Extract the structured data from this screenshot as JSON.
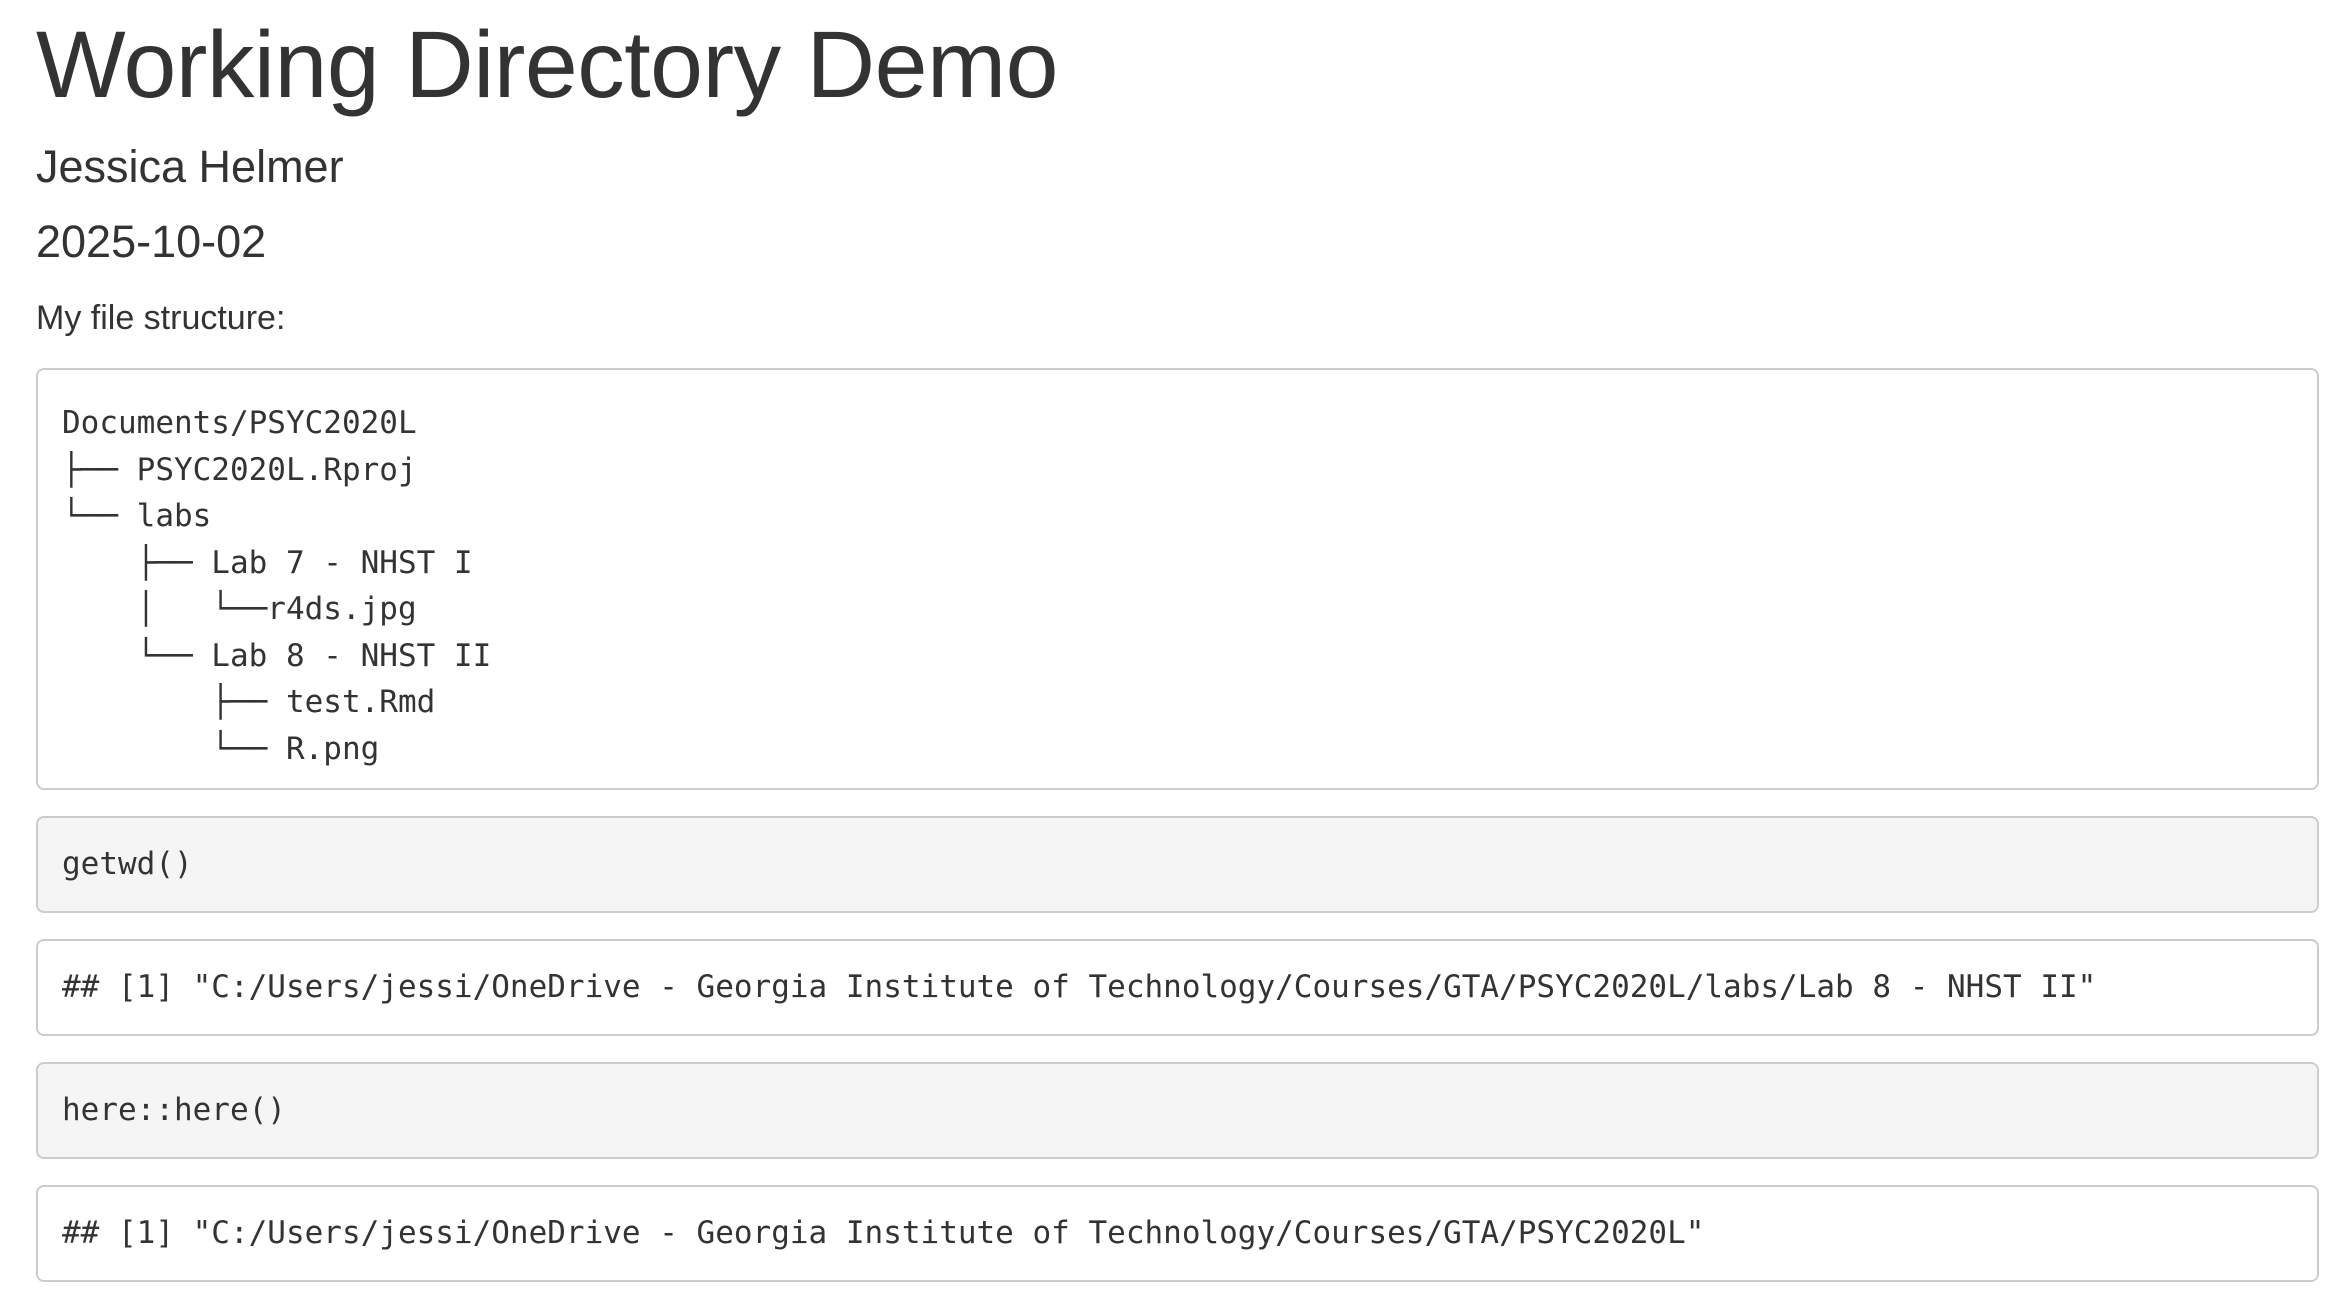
{
  "document": {
    "title": "Working Directory Demo",
    "author": "Jessica Helmer",
    "date": "2025-10-02",
    "intro": "My file structure:"
  },
  "file_tree": {
    "lines": [
      "Documents/PSYC2020L",
      "├── PSYC2020L.Rproj",
      "└── labs",
      "    ├── Lab 7 - NHST I",
      "    │   └──r4ds.jpg",
      "    └── Lab 8 - NHST II",
      "        ├── test.Rmd",
      "        └── R.png"
    ]
  },
  "code_chunks": [
    {
      "code": "getwd()",
      "output": "## [1] \"C:/Users/jessi/OneDrive - Georgia Institute of Technology/Courses/GTA/PSYC2020L/labs/Lab 8 - NHST II\""
    },
    {
      "code": "here::here()",
      "output": "## [1] \"C:/Users/jessi/OneDrive - Georgia Institute of Technology/Courses/GTA/PSYC2020L\""
    }
  ]
}
